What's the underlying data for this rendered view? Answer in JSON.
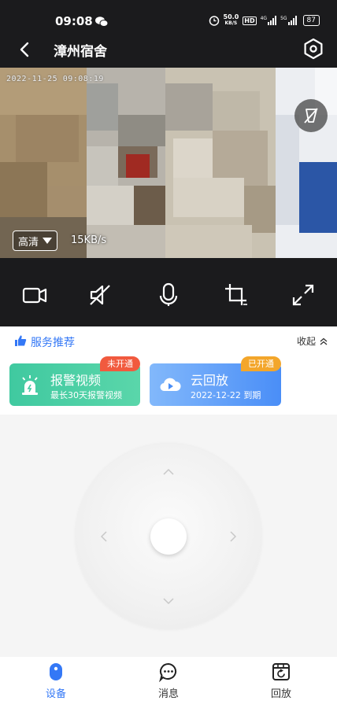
{
  "status_bar": {
    "time": "09:08",
    "net_speed": "50.0",
    "net_unit": "KB/S",
    "hd": "HD",
    "signal1_label": "4G",
    "signal2_label": "5G",
    "battery": "87"
  },
  "app_bar": {
    "title": "漳州宿舍"
  },
  "video": {
    "timestamp": "2022-11-25 09:08:19",
    "quality": "高清",
    "bitrate": "15KB/s"
  },
  "services": {
    "title": "服务推荐",
    "collapse_label": "收起",
    "cards": [
      {
        "title": "报警视频",
        "subtitle": "最长30天报警视频",
        "badge": "未开通",
        "badge_color": "#f15a3e"
      },
      {
        "title": "云回放",
        "subtitle": "2022-12-22 到期",
        "badge": "已开通",
        "badge_color": "#f3a62b"
      }
    ]
  },
  "bottom_nav": {
    "items": [
      {
        "label": "设备",
        "icon": "device-icon",
        "active": true
      },
      {
        "label": "消息",
        "icon": "message-icon",
        "active": false
      },
      {
        "label": "回放",
        "icon": "playback-icon",
        "active": false
      }
    ]
  },
  "colors": {
    "accent": "#3478f6",
    "dark": "#1b1b1d"
  }
}
